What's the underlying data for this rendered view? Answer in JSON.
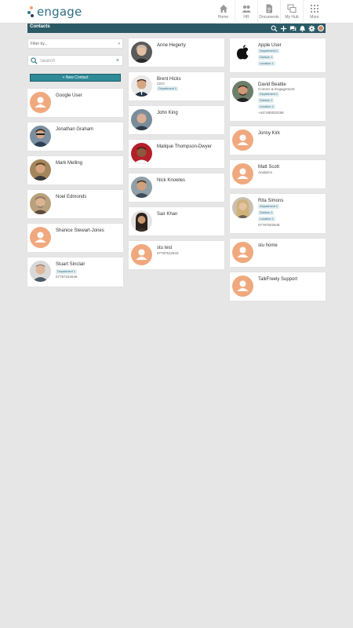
{
  "app": {
    "logo_text": "engage",
    "nav": [
      {
        "label": "Home",
        "icon": "home-icon"
      },
      {
        "label": "HR",
        "icon": "people-icon"
      },
      {
        "label": "Documents",
        "icon": "document-icon"
      },
      {
        "label": "My Hub",
        "icon": "hub-icon"
      },
      {
        "label": "More",
        "icon": "grid-icon"
      }
    ]
  },
  "page": {
    "title": "Contacts",
    "accent_color": "#2b5a66",
    "avatar_placeholder_color": "#f0a97e"
  },
  "filter": {
    "placeholder": "Filter by..."
  },
  "search": {
    "placeholder": "Search",
    "clear": "×"
  },
  "new_contact_label": "+ New Contact",
  "contacts": {
    "c1": {
      "name": "Google User"
    },
    "c2": {
      "name": "Jonathan Graham"
    },
    "c3": {
      "name": "Mark Melling"
    },
    "c4": {
      "name": "Noel Edmonds"
    },
    "c5": {
      "name": "Shanice Stewart-Jones"
    },
    "c6": {
      "name": "Stuart Sinclair",
      "tag1": "Department 1",
      "phone": "07797322648"
    },
    "c7": {
      "name": "Anne Hegerty"
    },
    "c8": {
      "name": "Brent Hicks",
      "role": "CEO",
      "tag1": "Department 1"
    },
    "c9": {
      "name": "John King"
    },
    "c10": {
      "name": "Malique Thompson-Dwyer"
    },
    "c11": {
      "name": "Nick Knowles"
    },
    "c12": {
      "name": "Sair Khan"
    },
    "c13": {
      "name": "stu test",
      "phone": "07787512643"
    },
    "c14": {
      "name": "Apple User",
      "tag1": "Department 1",
      "tag2": "Division 1",
      "tag3": "Location 1"
    },
    "c15": {
      "name": "David Beattie",
      "role": "Comms & Engagement",
      "tag1": "Department 1",
      "tag2": "Division 1",
      "tag3": "Location 1",
      "phone": "+447480020198"
    },
    "c16": {
      "name": "Jonny Kirk"
    },
    "c17": {
      "name": "Matt Scott",
      "role": "Analytics"
    },
    "c18": {
      "name": "Rita Simons",
      "tag1": "Department 1",
      "tag2": "Division 1",
      "tag3": "Location 1",
      "phone": "07787502648"
    },
    "c19": {
      "name": "stu home"
    },
    "c20": {
      "name": "TalkFreely Support"
    }
  }
}
